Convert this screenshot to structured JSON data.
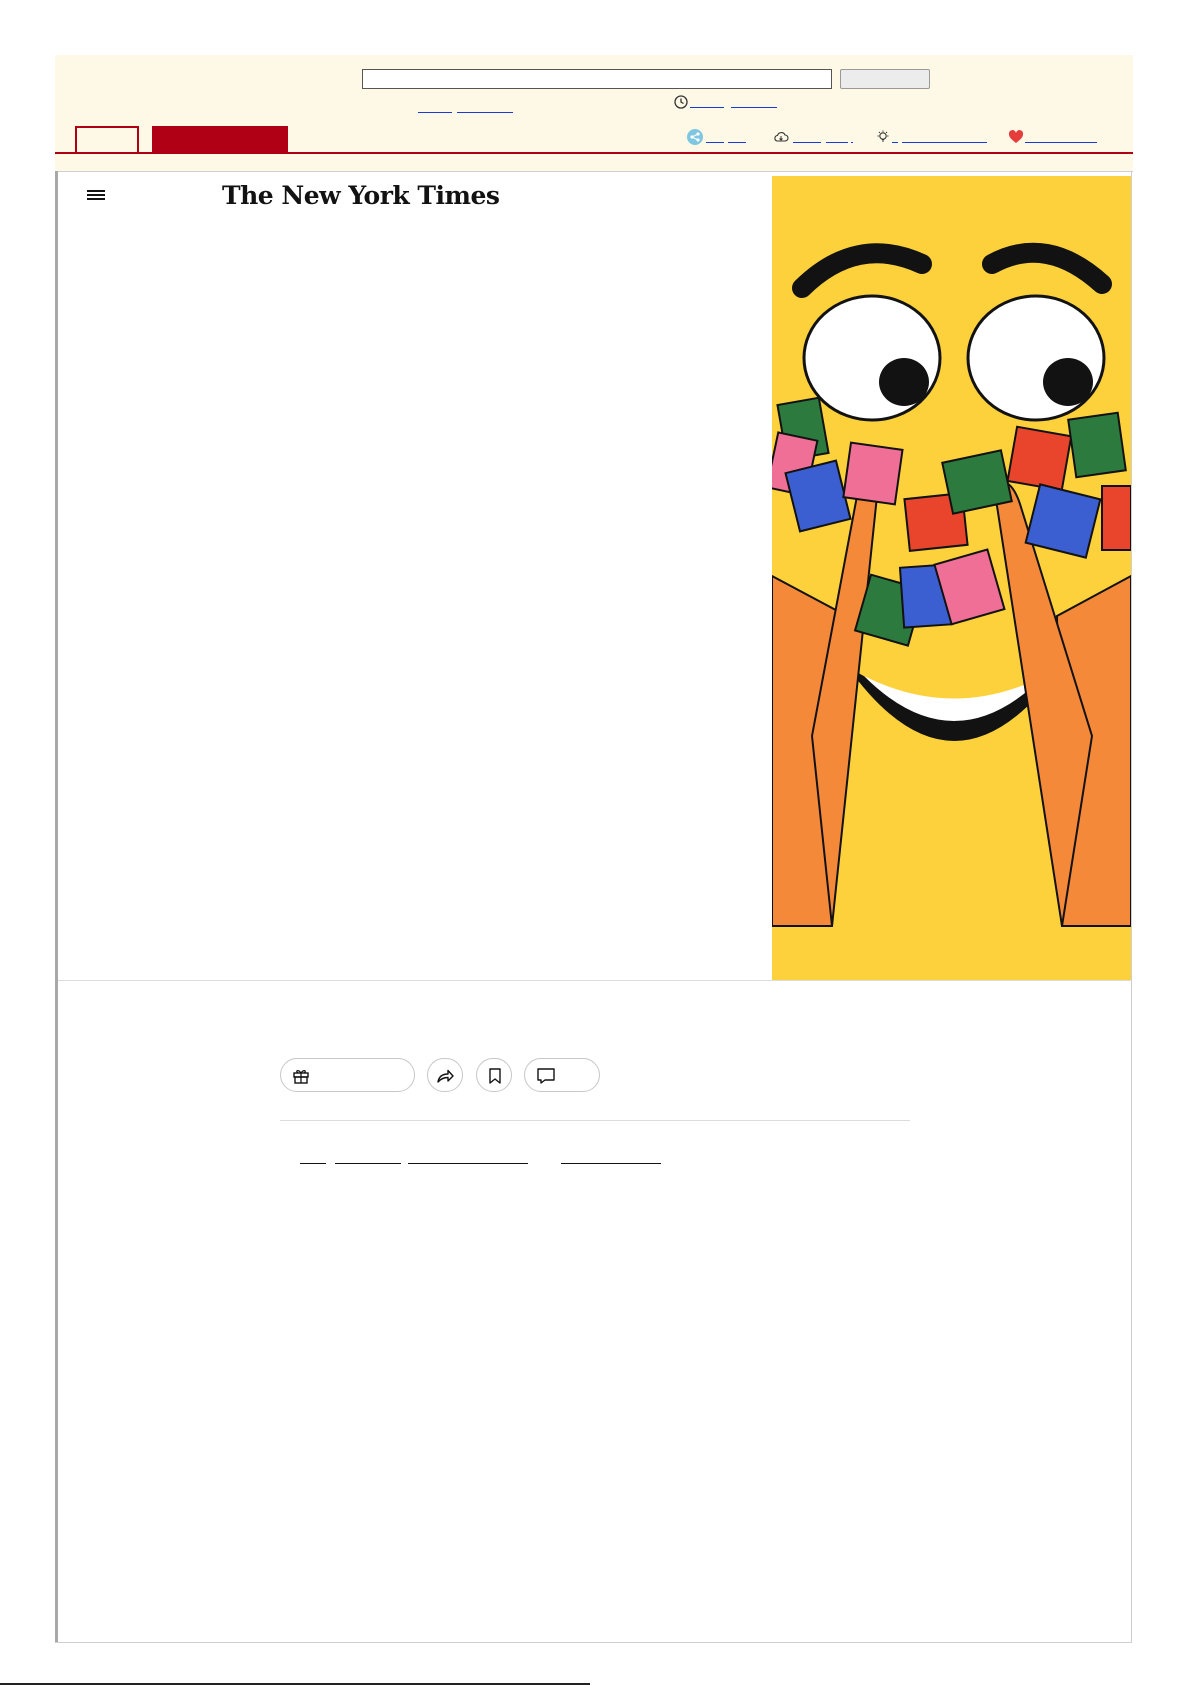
{
  "toolbar": {
    "url_value": "",
    "go_label": "",
    "calendar_link": "",
    "timestamp_link": "",
    "prev_link": "",
    "next_link": "",
    "tab_active_label": "",
    "tab_red_label": "",
    "share_label": "",
    "download_label": "",
    "about_label": "",
    "donate_label": "",
    "colors": {
      "background": "#fdf9e6",
      "accent": "#b00016",
      "link": "#1a3ad8"
    },
    "icons": [
      "clock-icon",
      "share-icon",
      "cloud-download-icon",
      "lightbulb-icon",
      "heart-icon"
    ]
  },
  "header": {
    "logo_text": "The New York Times",
    "menu_icon": "hamburger-menu-icon"
  },
  "hero": {
    "image_subject": "illustration",
    "colors": {
      "background": "#fdd13c",
      "hand": "#f5893a",
      "book_green": "#2d7a3f",
      "book_blue": "#3b5fd0",
      "book_pink": "#ef6f96",
      "book_red": "#e8452c"
    }
  },
  "actions": {
    "gift_label": "",
    "comments_count": "",
    "icons": [
      "gift-icon",
      "share-arrow-icon",
      "bookmark-icon",
      "comment-icon"
    ]
  },
  "byline": {
    "links": [
      "",
      "",
      "",
      ""
    ]
  },
  "footer": {
    "text": ""
  }
}
